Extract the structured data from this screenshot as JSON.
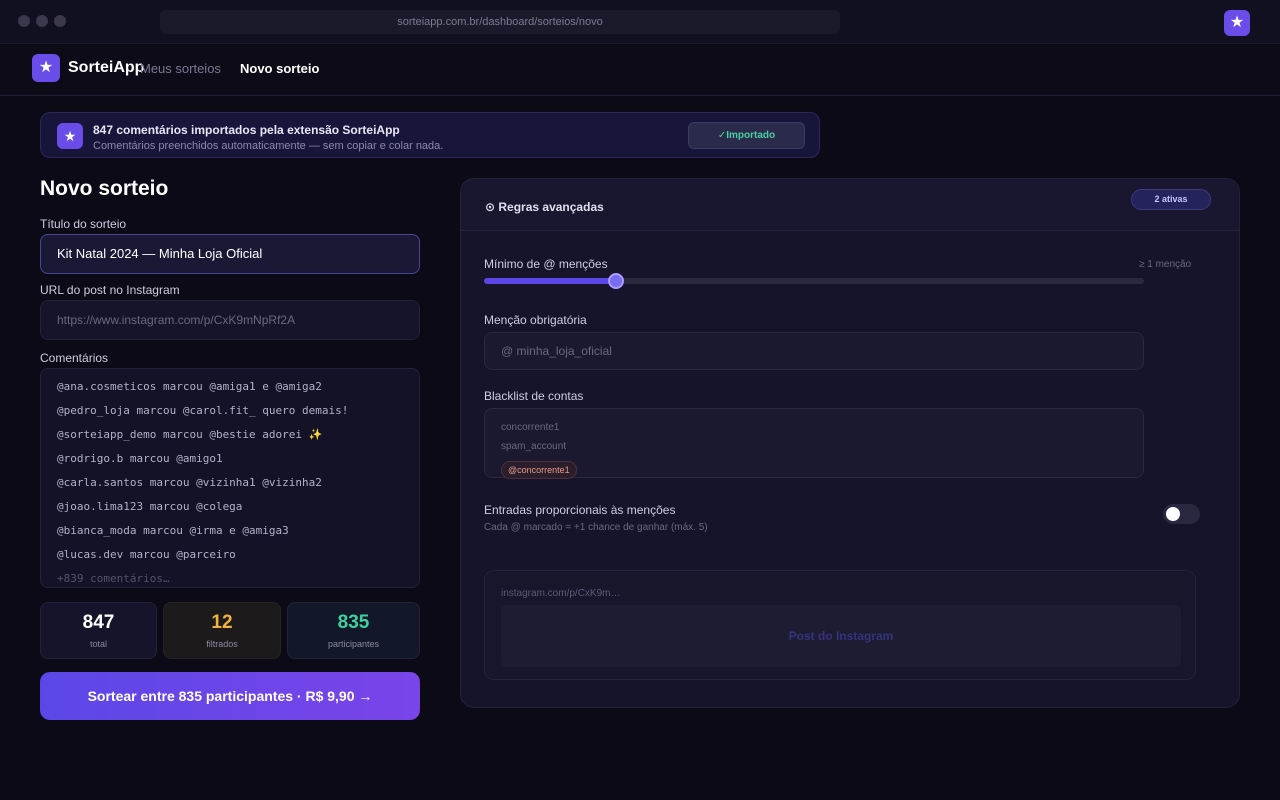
{
  "browser": {
    "url": "sorteiapp.com.br/dashboard/sorteios/novo",
    "extension_icon": "star-icon"
  },
  "nav": {
    "brand": "SorteiApp",
    "logo_icon": "star-icon",
    "links": [
      "Meus sorteios",
      "Novo sorteio"
    ],
    "active_link": "Novo sorteio"
  },
  "banner": {
    "icon": "star-icon",
    "title": "847 comentários importados pela extensão SorteiApp",
    "subtitle": "Comentários preenchidos automaticamente — sem copiar e colar nada.",
    "button": "✓Importado"
  },
  "form": {
    "page_title": "Novo sorteio",
    "title_label": "Título do sorteio",
    "title_value": "Kit Natal 2024 — Minha Loja Oficial",
    "url_label": "URL do post no Instagram",
    "url_value": "https://www.instagram.com/p/CxK9mNpRf2A",
    "comments_label": "Comentários",
    "comments": [
      "@ana.cosmeticos marcou @amiga1 e @amiga2",
      "@pedro_loja marcou @carol.fit_ quero demais!",
      "@sorteiapp_demo marcou @bestie adorei ✨",
      "@rodrigo.b marcou @amigo1",
      "@carla.santos marcou @vizinha1 @vizinha2",
      "@joao.lima123 marcou @colega",
      "@bianca_moda marcou @irma e @amiga3",
      "@lucas.dev marcou @parceiro"
    ],
    "comments_more": "+839 comentários…"
  },
  "stats": {
    "total": {
      "value": "847",
      "label": "total"
    },
    "filtered": {
      "value": "12",
      "label": "filtrados"
    },
    "participants": {
      "value": "835",
      "label": "participantes"
    }
  },
  "cta": "Sortear entre 835 participantes · R$ 9,90 →",
  "rules": {
    "title": "⊙ Regras avançadas",
    "badge": "2 ativas",
    "min_mentions_label": "Mínimo de @ menções",
    "min_mentions_hint": "≥ 1 menção",
    "min_mentions_fraction": 0.2,
    "required_mention_label": "Menção obrigatória",
    "required_mention_value": "@ minha_loja_oficial",
    "blacklist_label": "Blacklist de contas",
    "blacklist_lines": [
      "concorrente1",
      "spam_account"
    ],
    "blacklist_chip": "@concorrente1",
    "proportional_label": "Entradas proporcionais às menções",
    "proportional_hint": "Cada @ marcado = +1 chance de ganhar (máx. 5)",
    "proportional_enabled": false,
    "preview_url": "instagram.com/p/CxK9m…",
    "preview_label": "Post do Instagram"
  }
}
